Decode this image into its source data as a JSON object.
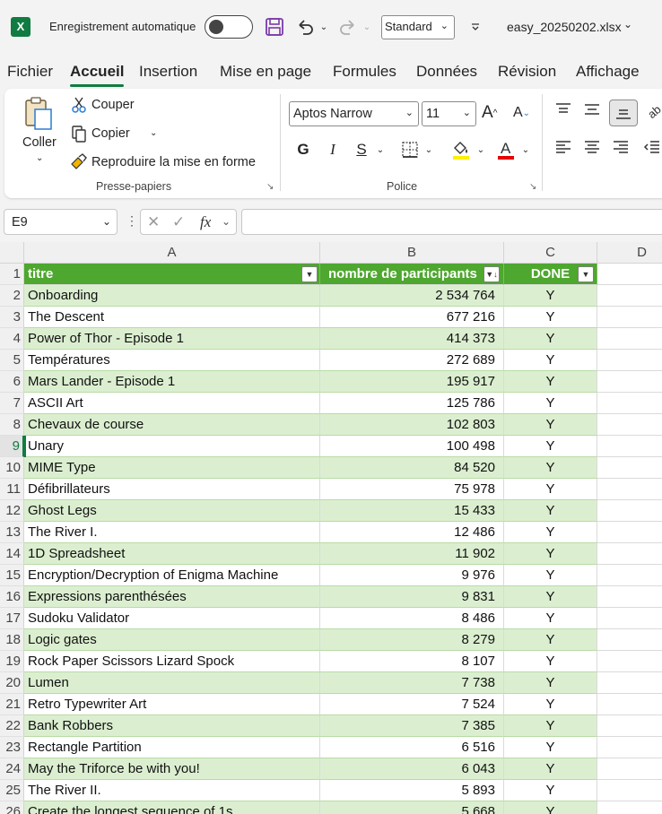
{
  "titlebar": {
    "logo": "X",
    "autosave_label": "Enregistrement automatique",
    "style_value": "Standard",
    "filename": "easy_20250202.xlsx",
    "accent": "#107c41"
  },
  "tabs": [
    "Fichier",
    "Accueil",
    "Insertion",
    "Mise en page",
    "Formules",
    "Données",
    "Révision",
    "Affichage"
  ],
  "ribbon": {
    "paste_label": "Coller",
    "cut_label": "Couper",
    "copy_label": "Copier",
    "format_painter_label": "Reproduire la mise en forme",
    "clipboard_group": "Presse-papiers",
    "font_name": "Aptos Narrow",
    "font_size": "11",
    "bold": "G",
    "italic": "I",
    "underline": "S",
    "font_group": "Police"
  },
  "formula_bar": {
    "name_box": "E9",
    "fx": "fx",
    "value": ""
  },
  "sheet": {
    "columns": [
      "A",
      "B",
      "C",
      "D"
    ],
    "headers": {
      "a": "titre",
      "b": "nombre de participants",
      "c": "DONE"
    },
    "rows": [
      {
        "n": "2",
        "a": "Onboarding",
        "b": "2 534 764",
        "c": "Y"
      },
      {
        "n": "3",
        "a": "The Descent",
        "b": "677 216",
        "c": "Y"
      },
      {
        "n": "4",
        "a": "Power of Thor - Episode 1",
        "b": "414 373",
        "c": "Y"
      },
      {
        "n": "5",
        "a": "Températures",
        "b": "272 689",
        "c": "Y"
      },
      {
        "n": "6",
        "a": "Mars Lander - Episode 1",
        "b": "195 917",
        "c": "Y"
      },
      {
        "n": "7",
        "a": "ASCII Art",
        "b": "125 786",
        "c": "Y"
      },
      {
        "n": "8",
        "a": "Chevaux de course",
        "b": "102 803",
        "c": "Y"
      },
      {
        "n": "9",
        "a": "Unary",
        "b": "100 498",
        "c": "Y"
      },
      {
        "n": "10",
        "a": "MIME Type",
        "b": "84 520",
        "c": "Y"
      },
      {
        "n": "11",
        "a": "Défibrillateurs",
        "b": "75 978",
        "c": "Y"
      },
      {
        "n": "12",
        "a": "Ghost Legs",
        "b": "15 433",
        "c": "Y"
      },
      {
        "n": "13",
        "a": "The River I.",
        "b": "12 486",
        "c": "Y"
      },
      {
        "n": "14",
        "a": "1D Spreadsheet",
        "b": "11 902",
        "c": "Y"
      },
      {
        "n": "15",
        "a": "Encryption/Decryption of Enigma Machine",
        "b": "9 976",
        "c": "Y"
      },
      {
        "n": "16",
        "a": "Expressions parenthésées",
        "b": "9 831",
        "c": "Y"
      },
      {
        "n": "17",
        "a": "Sudoku Validator",
        "b": "8 486",
        "c": "Y"
      },
      {
        "n": "18",
        "a": "Logic gates",
        "b": "8 279",
        "c": "Y"
      },
      {
        "n": "19",
        "a": "Rock Paper Scissors Lizard Spock",
        "b": "8 107",
        "c": "Y"
      },
      {
        "n": "20",
        "a": "Lumen",
        "b": "7 738",
        "c": "Y"
      },
      {
        "n": "21",
        "a": "Retro Typewriter Art",
        "b": "7 524",
        "c": "Y"
      },
      {
        "n": "22",
        "a": "Bank Robbers",
        "b": "7 385",
        "c": "Y"
      },
      {
        "n": "23",
        "a": "Rectangle Partition",
        "b": "6 516",
        "c": "Y"
      },
      {
        "n": "24",
        "a": "May the Triforce be with you!",
        "b": "6 043",
        "c": "Y"
      },
      {
        "n": "25",
        "a": "The River II.",
        "b": "5 893",
        "c": "Y"
      },
      {
        "n": "26",
        "a": "Create the longest sequence of 1s",
        "b": "5 668",
        "c": "Y"
      }
    ],
    "table_header_color": "#4ea72e",
    "band_color": "#dbefd0"
  }
}
